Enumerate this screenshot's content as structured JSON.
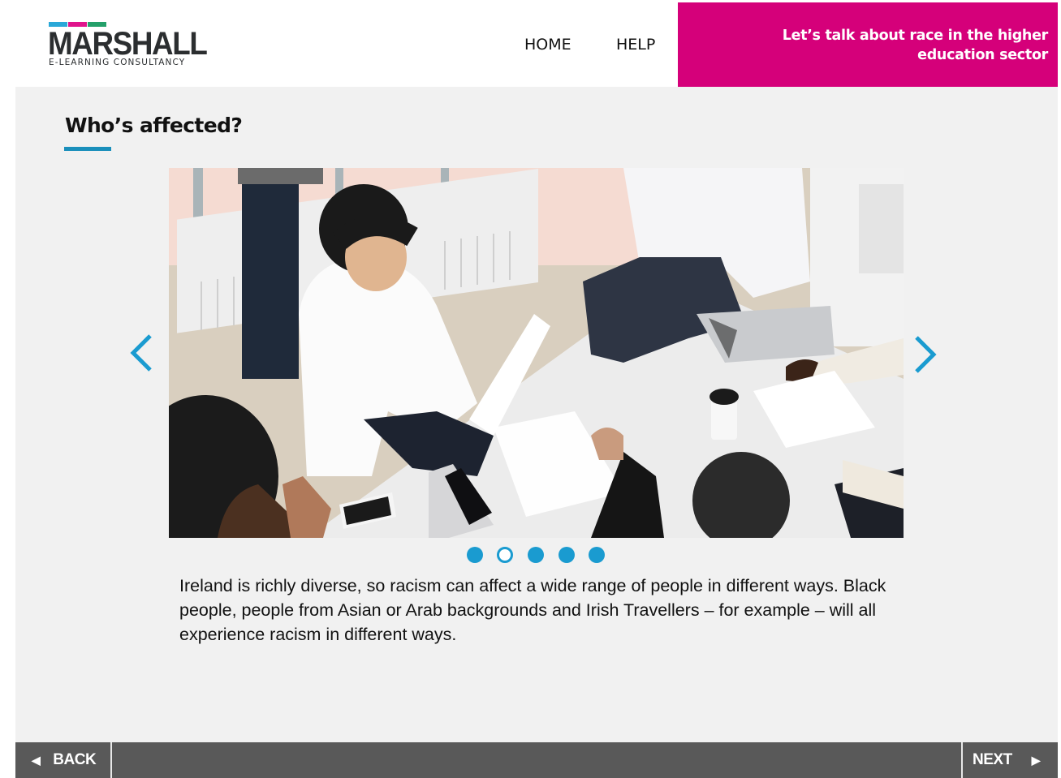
{
  "brand": {
    "logo_name": "MARSHALL",
    "logo_tagline": "E-LEARNING CONSULTANCY",
    "logo_bar_colors": [
      "#2aa8d8",
      "#e0148c",
      "#24a06a"
    ]
  },
  "nav": {
    "home_label": "HOME",
    "help_label": "HELP"
  },
  "course": {
    "title": "Let’s talk about race in the higher education sector",
    "accent_color": "#d5007a"
  },
  "page": {
    "title": "Who’s affected?",
    "accent_color": "#1a8fbb"
  },
  "carousel": {
    "image_alt": "Diverse group of colleagues meeting around an office table, viewed from above",
    "slide_count": 5,
    "active_index": 1,
    "prev_icon": "chevron-left-icon",
    "next_icon": "chevron-right-icon",
    "caption": "Ireland is richly diverse, so racism can affect a wide range of people in different ways. Black people, people from Asian or Arab backgrounds and Irish Travellers – for example – will all experience racism in different ways."
  },
  "footer": {
    "back_label": "BACK",
    "next_label": "NEXT",
    "back_icon": "◀",
    "next_icon": "▶"
  }
}
